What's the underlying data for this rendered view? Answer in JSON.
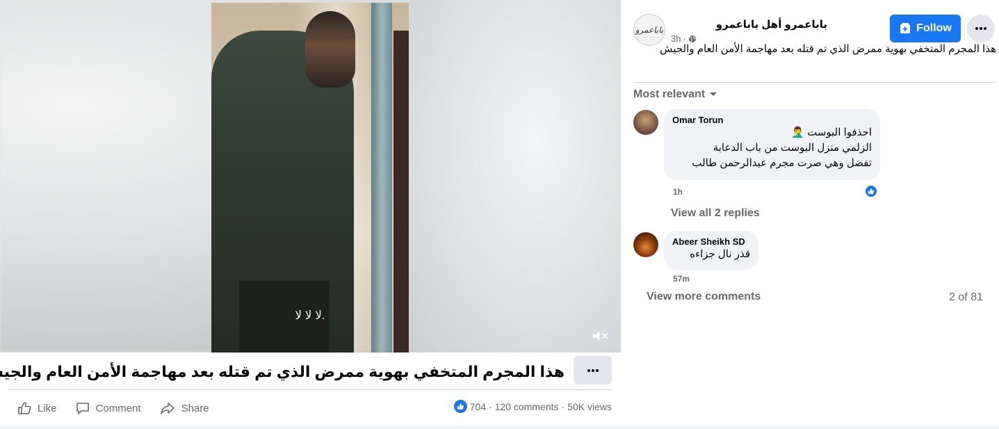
{
  "video": {
    "caption": "لا لا لا."
  },
  "post": {
    "title": "هذا المجرم المتخفي بهوية ممرض الذي تم قتله بعد مهاجمة الأمن العام والجيش",
    "actions": {
      "like": "Like",
      "comment": "Comment",
      "share": "Share"
    },
    "stats": {
      "reactions": "704",
      "comments": "120 comments",
      "views": "50K views",
      "sep": "·"
    }
  },
  "side": {
    "page_name": "باباعمرو أهل باباعمرو",
    "page_avatar_text": "باباعمرو",
    "time": "3h",
    "follow_label": "Follow",
    "post_text": "هذا المجرم المتخفي بهوية ممرض الذي تم قتله بعد مهاجمة الأمن العام والجيش",
    "sort_label": "Most relevant",
    "comments": [
      {
        "author": "Omar Torun",
        "text": "احذفوا البوست 🤦‍♂️\nالزلمي منزل البوست من باب الدعابة\nتفضل وهي صرت مجرم عبدالرحمن طالب",
        "time": "1h"
      },
      {
        "author": "Abeer Sheikh SD",
        "text": "قذر نال جزاءه",
        "time": "57m"
      }
    ],
    "view_replies": "View all 2 replies",
    "view_more": "View more comments",
    "count": "2 of 81"
  },
  "colors": {
    "accent": "#1877f2",
    "muted": "#65676b",
    "bubble": "#f0f2f5"
  },
  "icons": [
    "mute-icon",
    "more-icon",
    "like-icon",
    "comment-icon",
    "share-icon",
    "follow-icon",
    "globe-icon",
    "chevron-down-icon"
  ]
}
